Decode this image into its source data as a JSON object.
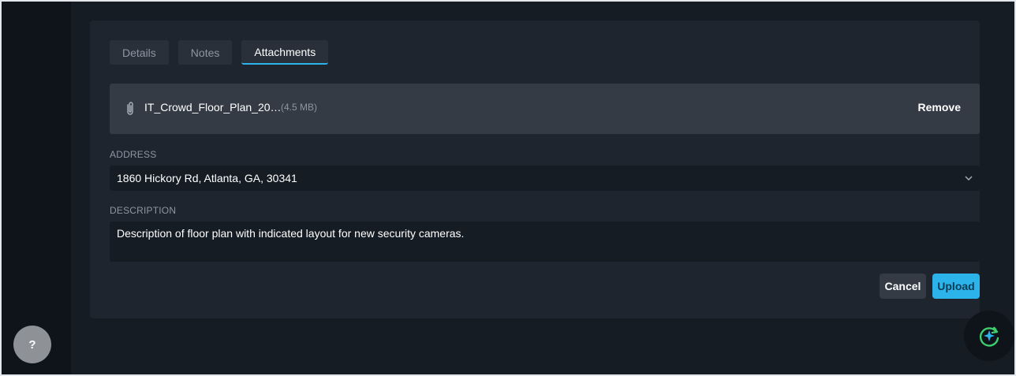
{
  "tabs": [
    {
      "label": "Details"
    },
    {
      "label": "Notes"
    },
    {
      "label": "Attachments"
    }
  ],
  "attachment": {
    "icon": "paperclip-icon",
    "file_name": "IT_Crowd_Floor_Plan_20…",
    "file_size": "(4.5 MB)",
    "remove_label": "Remove"
  },
  "address": {
    "label": "ADDRESS",
    "value": "1860 Hickory Rd, Atlanta, GA, 30341"
  },
  "description": {
    "label": "DESCRIPTION",
    "value": "Description of floor plan with indicated layout for new security cameras."
  },
  "actions": {
    "cancel_label": "Cancel",
    "upload_label": "Upload"
  },
  "help": {
    "label": "?"
  },
  "colors": {
    "accent": "#2bb3ea",
    "assistant_green": "#3ecf6e",
    "background": "#161c24",
    "card": "#1f252e"
  }
}
